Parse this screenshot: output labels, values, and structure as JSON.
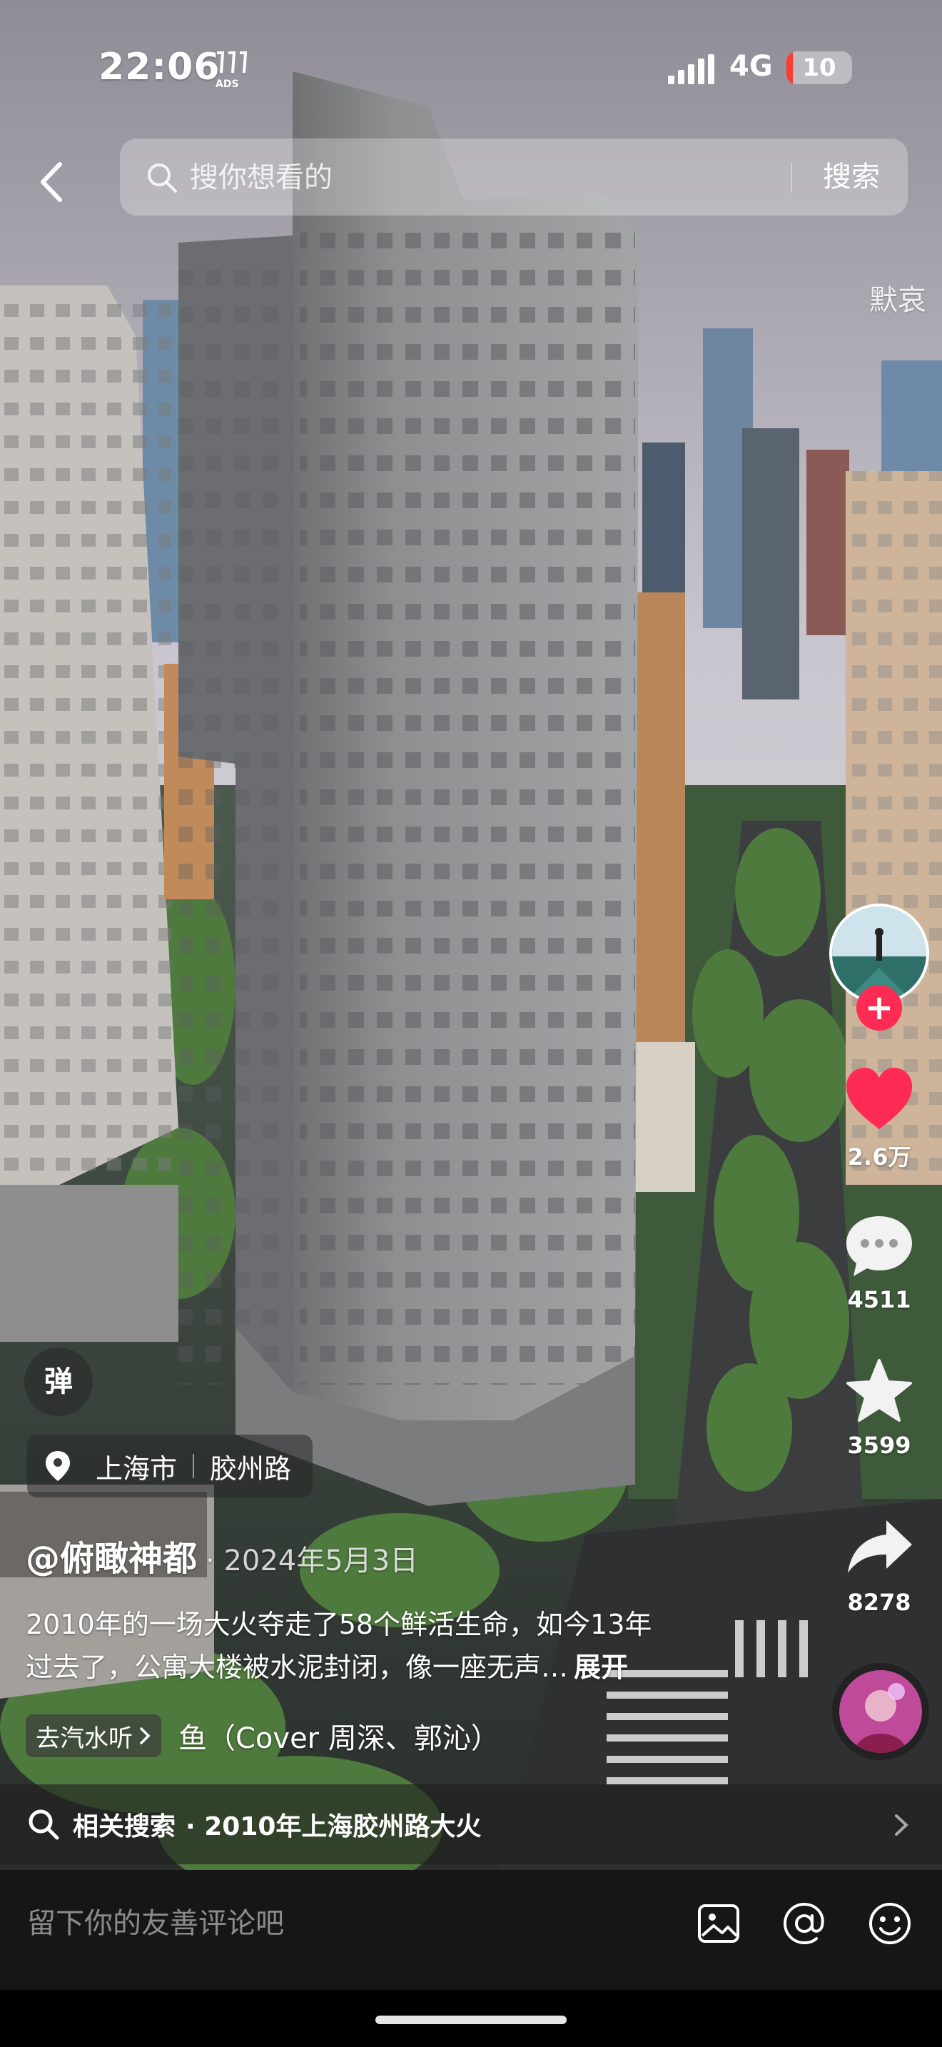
{
  "status_bar": {
    "time": "22:06",
    "network": "4G",
    "battery_level": "10",
    "battery_fraction": 0.1,
    "battery_color": "#ff3b30"
  },
  "search": {
    "placeholder": "搜你想看的",
    "button_label": "搜索"
  },
  "overlay": {
    "mourning_text": "默哀"
  },
  "actions": {
    "likes": "2.6万",
    "comments": "4511",
    "favorites": "3599",
    "shares": "8278",
    "like_color": "#fe2c55"
  },
  "post": {
    "danmaku_label": "弹",
    "location_city": "上海市",
    "location_place": "胶州路",
    "author": "@俯瞰神都",
    "date": "· 2024年5月3日",
    "caption_line1": "2010年的一场大火夺走了58个鲜活生命，如今13年",
    "caption_line2": "过去了，公寓大楼被水泥封闭，像一座无声…",
    "expand_label": "展开",
    "music_chip": "去汽水听",
    "music_title": "鱼（Cover 周深、郭沁）"
  },
  "related": {
    "label": "相关搜索",
    "query": "· 2010年上海胶州路大火"
  },
  "comment_bar": {
    "placeholder": "留下你的友善评论吧"
  },
  "icons": [
    "back-arrow-icon",
    "search-icon",
    "heart-icon",
    "comment-icon",
    "star-icon",
    "share-icon",
    "location-pin-icon",
    "chevron-right-icon",
    "image-icon",
    "mention-icon",
    "emoji-icon"
  ]
}
